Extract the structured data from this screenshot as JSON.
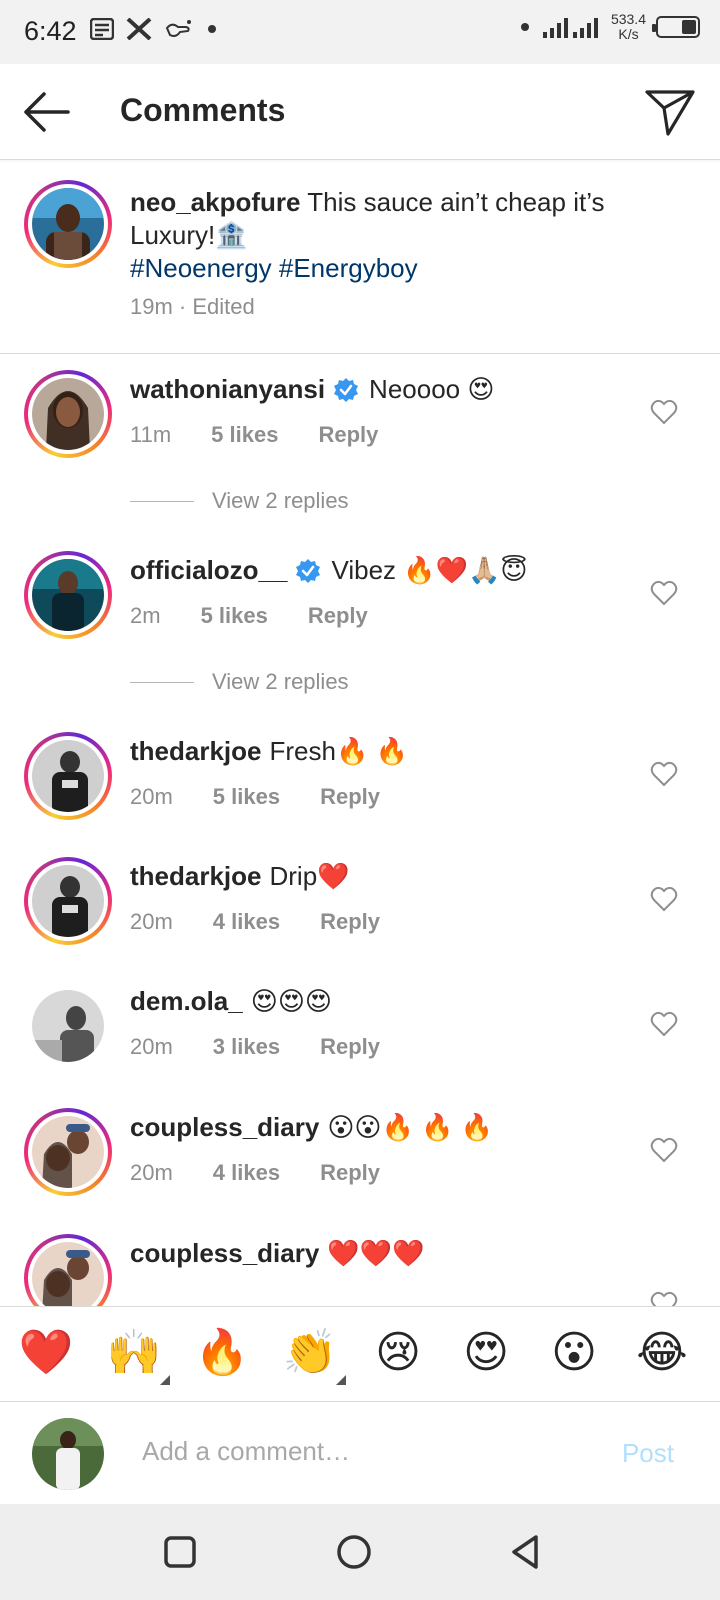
{
  "status_bar": {
    "time": "6:42",
    "network_speed_value": "533.4",
    "network_speed_unit": "K/s"
  },
  "header": {
    "title": "Comments"
  },
  "caption": {
    "username": "neo_akpofure",
    "text": "This sauce ain’t cheap it’s Luxury!🏦",
    "hashtags": "#Neoenergy #Energyboy",
    "meta": "19m · Edited"
  },
  "comments": [
    {
      "username": "wathonianyansi",
      "verified": true,
      "text": "Neoooo 😍",
      "time": "11m",
      "likes": "5 likes",
      "reply": "Reply",
      "view_replies": "View 2 replies"
    },
    {
      "username": "officialozo__",
      "verified": true,
      "text": "Vibez 🔥❤️🙏🏼😇",
      "time": "2m",
      "likes": "5 likes",
      "reply": "Reply",
      "view_replies": "View 2 replies"
    },
    {
      "username": "thedarkjoe",
      "verified": false,
      "text": "Fresh🔥 🔥",
      "time": "20m",
      "likes": "5 likes",
      "reply": "Reply"
    },
    {
      "username": "thedarkjoe",
      "verified": false,
      "text": "Drip❤️",
      "time": "20m",
      "likes": "4 likes",
      "reply": "Reply"
    },
    {
      "username": "dem.ola_",
      "verified": false,
      "text": "😍😍😍",
      "time": "20m",
      "likes": "3 likes",
      "reply": "Reply"
    },
    {
      "username": "coupless_diary",
      "verified": false,
      "text": "😮😮🔥 🔥 🔥",
      "time": "20m",
      "likes": "4 likes",
      "reply": "Reply"
    },
    {
      "username": "coupless_diary",
      "verified": false,
      "text": "❤️❤️❤️",
      "time": "",
      "likes": "",
      "reply": ""
    }
  ],
  "reactions": [
    "❤️",
    "🙌",
    "🔥",
    "👏",
    "😢",
    "😍",
    "😮",
    "😂"
  ],
  "add_comment": {
    "placeholder": "Add a comment…",
    "post_label": "Post"
  },
  "colors": {
    "hashtag": "#00376b",
    "verified": "#3897f0",
    "muted": "#8e8e8e",
    "post_disabled": "#b2dffc"
  }
}
